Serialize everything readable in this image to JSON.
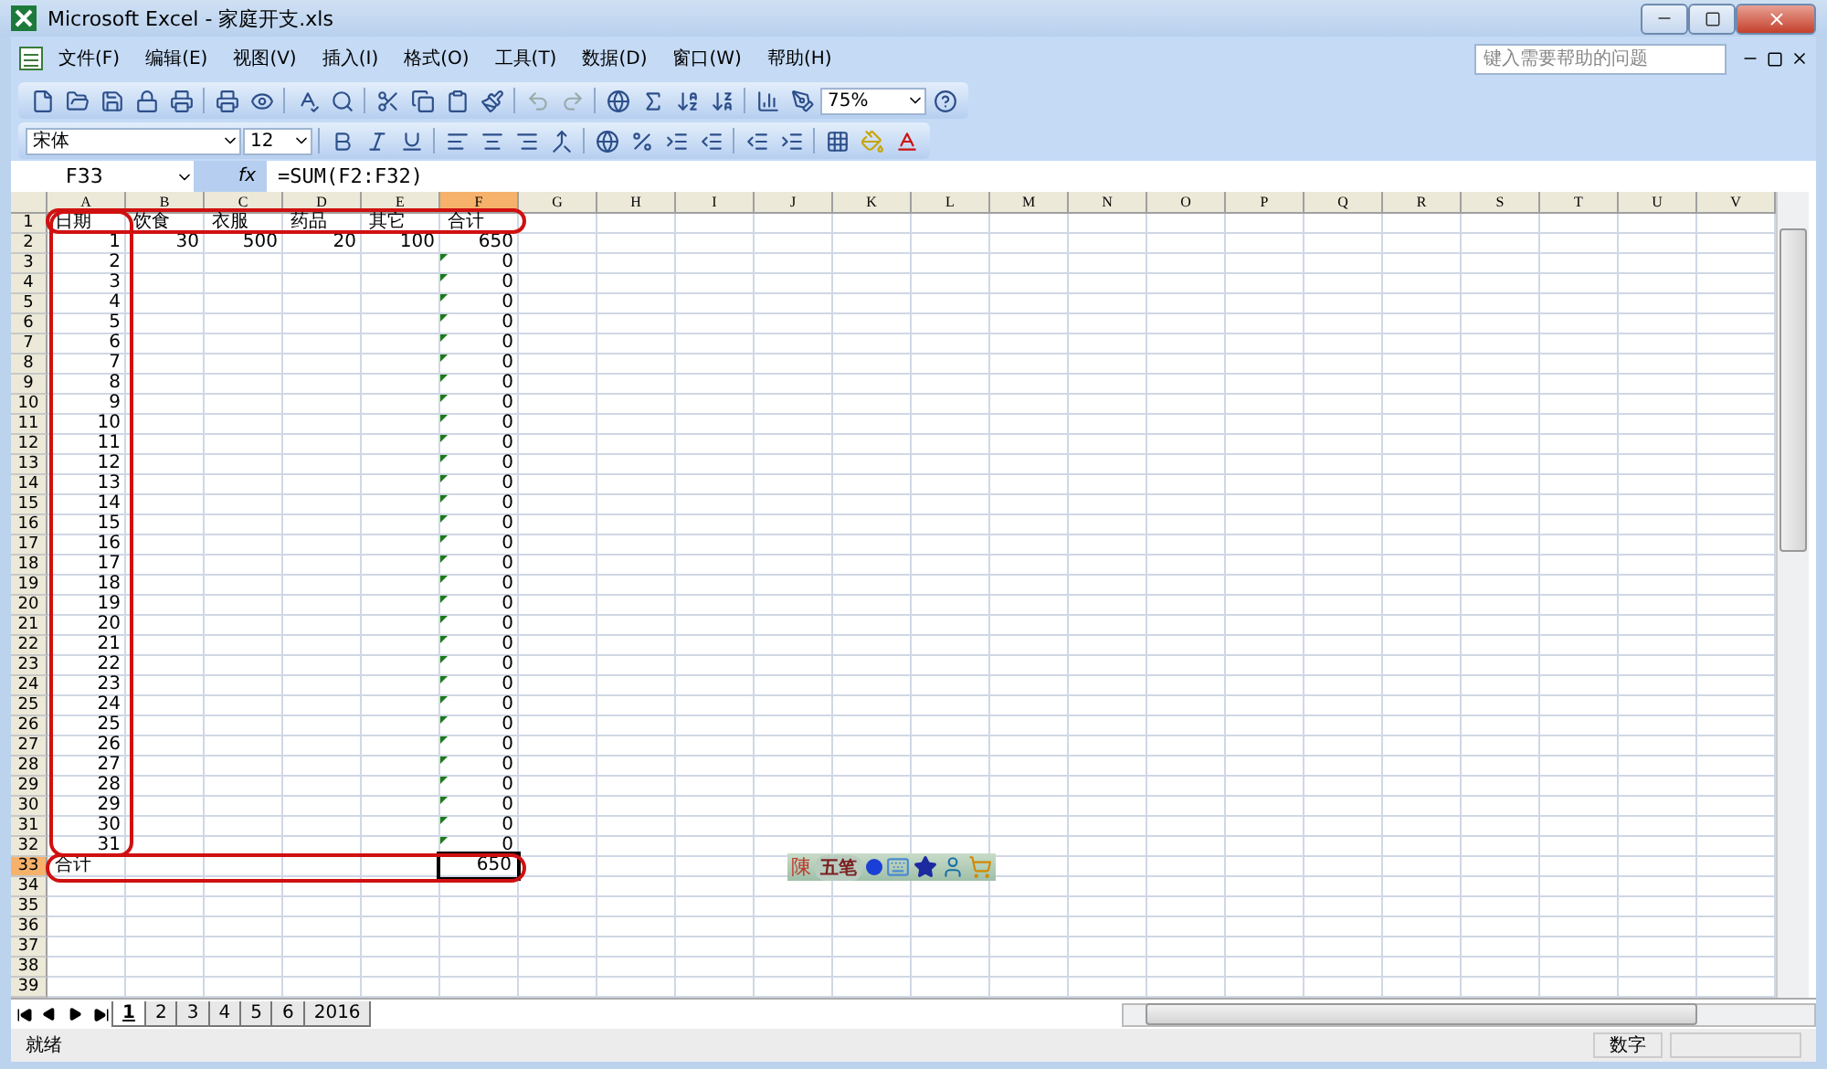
{
  "window": {
    "title": "Microsoft Excel - 家庭开支.xls"
  },
  "menu": [
    "文件(F)",
    "编辑(E)",
    "视图(V)",
    "插入(I)",
    "格式(O)",
    "工具(T)",
    "数据(D)",
    "窗口(W)",
    "帮助(H)"
  ],
  "help_box": {
    "placeholder": "键入需要帮助的问题"
  },
  "toolbar": {
    "zoom": "75%",
    "font": "宋体",
    "size": "12"
  },
  "formula_bar": {
    "name_box": "F33",
    "fx": "fx",
    "formula": "=SUM(F2:F32)"
  },
  "columns": [
    {
      "label": "A",
      "selected": false
    },
    {
      "label": "B",
      "selected": false
    },
    {
      "label": "C",
      "selected": false
    },
    {
      "label": "D",
      "selected": false
    },
    {
      "label": "E",
      "selected": false
    },
    {
      "label": "F",
      "selected": true
    },
    {
      "label": "G",
      "selected": false
    },
    {
      "label": "H",
      "selected": false
    },
    {
      "label": "I",
      "selected": false
    },
    {
      "label": "J",
      "selected": false
    },
    {
      "label": "K",
      "selected": false
    },
    {
      "label": "L",
      "selected": false
    },
    {
      "label": "M",
      "selected": false
    },
    {
      "label": "N",
      "selected": false
    },
    {
      "label": "O",
      "selected": false
    },
    {
      "label": "P",
      "selected": false
    },
    {
      "label": "Q",
      "selected": false
    },
    {
      "label": "R",
      "selected": false
    },
    {
      "label": "S",
      "selected": false
    },
    {
      "label": "T",
      "selected": false
    },
    {
      "label": "U",
      "selected": false
    },
    {
      "label": "V",
      "selected": false
    }
  ],
  "rows": [
    {
      "number": "1",
      "kind": "header",
      "selected": false,
      "cells": [
        {
          "text": "日期",
          "selected": false
        },
        {
          "text": "饮食",
          "selected": false
        },
        {
          "text": "衣服",
          "selected": false
        },
        {
          "text": "药品",
          "selected": false
        },
        {
          "text": "其它",
          "selected": false
        },
        {
          "text": "合计",
          "selected": false
        }
      ]
    },
    {
      "number": "2",
      "kind": "data",
      "selected": false,
      "cells": [
        {
          "text": "1",
          "selected": false
        },
        {
          "text": "30",
          "selected": false
        },
        {
          "text": "500",
          "selected": false
        },
        {
          "text": "20",
          "selected": false
        },
        {
          "text": "100",
          "selected": false
        },
        {
          "text": "650",
          "selected": false
        }
      ]
    },
    {
      "number": "3",
      "kind": "data",
      "selected": false,
      "flagged": true,
      "cells": [
        {
          "text": "2",
          "selected": false
        },
        null,
        null,
        null,
        null,
        {
          "text": "0",
          "selected": false
        }
      ]
    },
    {
      "number": "4",
      "kind": "data",
      "selected": false,
      "flagged": true,
      "cells": [
        {
          "text": "3",
          "selected": false
        },
        null,
        null,
        null,
        null,
        {
          "text": "0",
          "selected": false
        }
      ]
    },
    {
      "number": "5",
      "kind": "data",
      "selected": false,
      "flagged": true,
      "cells": [
        {
          "text": "4",
          "selected": false
        },
        null,
        null,
        null,
        null,
        {
          "text": "0",
          "selected": false
        }
      ]
    },
    {
      "number": "6",
      "kind": "data",
      "selected": false,
      "flagged": true,
      "cells": [
        {
          "text": "5",
          "selected": false
        },
        null,
        null,
        null,
        null,
        {
          "text": "0",
          "selected": false
        }
      ]
    },
    {
      "number": "7",
      "kind": "data",
      "selected": false,
      "flagged": true,
      "cells": [
        {
          "text": "6",
          "selected": false
        },
        null,
        null,
        null,
        null,
        {
          "text": "0",
          "selected": false
        }
      ]
    },
    {
      "number": "8",
      "kind": "data",
      "selected": false,
      "flagged": true,
      "cells": [
        {
          "text": "7",
          "selected": false
        },
        null,
        null,
        null,
        null,
        {
          "text": "0",
          "selected": false
        }
      ]
    },
    {
      "number": "9",
      "kind": "data",
      "selected": false,
      "flagged": true,
      "cells": [
        {
          "text": "8",
          "selected": false
        },
        null,
        null,
        null,
        null,
        {
          "text": "0",
          "selected": false
        }
      ]
    },
    {
      "number": "10",
      "kind": "data",
      "selected": false,
      "flagged": true,
      "cells": [
        {
          "text": "9",
          "selected": false
        },
        null,
        null,
        null,
        null,
        {
          "text": "0",
          "selected": false
        }
      ]
    },
    {
      "number": "11",
      "kind": "data",
      "selected": false,
      "flagged": true,
      "cells": [
        {
          "text": "10",
          "selected": false
        },
        null,
        null,
        null,
        null,
        {
          "text": "0",
          "selected": false
        }
      ]
    },
    {
      "number": "12",
      "kind": "data",
      "selected": false,
      "flagged": true,
      "cells": [
        {
          "text": "11",
          "selected": false
        },
        null,
        null,
        null,
        null,
        {
          "text": "0",
          "selected": false
        }
      ]
    },
    {
      "number": "13",
      "kind": "data",
      "selected": false,
      "flagged": true,
      "cells": [
        {
          "text": "12",
          "selected": false
        },
        null,
        null,
        null,
        null,
        {
          "text": "0",
          "selected": false
        }
      ]
    },
    {
      "number": "14",
      "kind": "data",
      "selected": false,
      "flagged": true,
      "cells": [
        {
          "text": "13",
          "selected": false
        },
        null,
        null,
        null,
        null,
        {
          "text": "0",
          "selected": false
        }
      ]
    },
    {
      "number": "15",
      "kind": "data",
      "selected": false,
      "flagged": true,
      "cells": [
        {
          "text": "14",
          "selected": false
        },
        null,
        null,
        null,
        null,
        {
          "text": "0",
          "selected": false
        }
      ]
    },
    {
      "number": "16",
      "kind": "data",
      "selected": false,
      "flagged": true,
      "cells": [
        {
          "text": "15",
          "selected": false
        },
        null,
        null,
        null,
        null,
        {
          "text": "0",
          "selected": false
        }
      ]
    },
    {
      "number": "17",
      "kind": "data",
      "selected": false,
      "flagged": true,
      "cells": [
        {
          "text": "16",
          "selected": false
        },
        null,
        null,
        null,
        null,
        {
          "text": "0",
          "selected": false
        }
      ]
    },
    {
      "number": "18",
      "kind": "data",
      "selected": false,
      "flagged": true,
      "cells": [
        {
          "text": "17",
          "selected": false
        },
        null,
        null,
        null,
        null,
        {
          "text": "0",
          "selected": false
        }
      ]
    },
    {
      "number": "19",
      "kind": "data",
      "selected": false,
      "flagged": true,
      "cells": [
        {
          "text": "18",
          "selected": false
        },
        null,
        null,
        null,
        null,
        {
          "text": "0",
          "selected": false
        }
      ]
    },
    {
      "number": "20",
      "kind": "data",
      "selected": false,
      "flagged": true,
      "cells": [
        {
          "text": "19",
          "selected": false
        },
        null,
        null,
        null,
        null,
        {
          "text": "0",
          "selected": false
        }
      ]
    },
    {
      "number": "21",
      "kind": "data",
      "selected": false,
      "flagged": true,
      "cells": [
        {
          "text": "20",
          "selected": false
        },
        null,
        null,
        null,
        null,
        {
          "text": "0",
          "selected": false
        }
      ]
    },
    {
      "number": "22",
      "kind": "data",
      "selected": false,
      "flagged": true,
      "cells": [
        {
          "text": "21",
          "selected": false
        },
        null,
        null,
        null,
        null,
        {
          "text": "0",
          "selected": false
        }
      ]
    },
    {
      "number": "23",
      "kind": "data",
      "selected": false,
      "flagged": true,
      "cells": [
        {
          "text": "22",
          "selected": false
        },
        null,
        null,
        null,
        null,
        {
          "text": "0",
          "selected": false
        }
      ]
    },
    {
      "number": "24",
      "kind": "data",
      "selected": false,
      "flagged": true,
      "cells": [
        {
          "text": "23",
          "selected": false
        },
        null,
        null,
        null,
        null,
        {
          "text": "0",
          "selected": false
        }
      ]
    },
    {
      "number": "25",
      "kind": "data",
      "selected": false,
      "flagged": true,
      "cells": [
        {
          "text": "24",
          "selected": false
        },
        null,
        null,
        null,
        null,
        {
          "text": "0",
          "selected": false
        }
      ]
    },
    {
      "number": "26",
      "kind": "data",
      "selected": false,
      "flagged": true,
      "cells": [
        {
          "text": "25",
          "selected": false
        },
        null,
        null,
        null,
        null,
        {
          "text": "0",
          "selected": false
        }
      ]
    },
    {
      "number": "27",
      "kind": "data",
      "selected": false,
      "flagged": true,
      "cells": [
        {
          "text": "26",
          "selected": false
        },
        null,
        null,
        null,
        null,
        {
          "text": "0",
          "selected": false
        }
      ]
    },
    {
      "number": "28",
      "kind": "data",
      "selected": false,
      "flagged": true,
      "cells": [
        {
          "text": "27",
          "selected": false
        },
        null,
        null,
        null,
        null,
        {
          "text": "0",
          "selected": false
        }
      ]
    },
    {
      "number": "29",
      "kind": "data",
      "selected": false,
      "flagged": true,
      "cells": [
        {
          "text": "28",
          "selected": false
        },
        null,
        null,
        null,
        null,
        {
          "text": "0",
          "selected": false
        }
      ]
    },
    {
      "number": "30",
      "kind": "data",
      "selected": false,
      "flagged": true,
      "cells": [
        {
          "text": "29",
          "selected": false
        },
        null,
        null,
        null,
        null,
        {
          "text": "0",
          "selected": false
        }
      ]
    },
    {
      "number": "31",
      "kind": "data",
      "selected": false,
      "flagged": true,
      "cells": [
        {
          "text": "30",
          "selected": false
        },
        null,
        null,
        null,
        null,
        {
          "text": "0",
          "selected": false
        }
      ]
    },
    {
      "number": "32",
      "kind": "data",
      "selected": false,
      "flagged": true,
      "cells": [
        {
          "text": "31",
          "selected": false
        },
        null,
        null,
        null,
        null,
        {
          "text": "0",
          "selected": false
        }
      ]
    },
    {
      "number": "33",
      "kind": "total",
      "selected": true,
      "cells": [
        {
          "text": "合计",
          "selected": false
        },
        null,
        null,
        null,
        null,
        {
          "text": "650",
          "selected": true
        }
      ]
    },
    {
      "number": "34",
      "kind": "empty",
      "selected": false
    },
    {
      "number": "35",
      "kind": "empty",
      "selected": false
    },
    {
      "number": "36",
      "kind": "empty",
      "selected": false
    },
    {
      "number": "37",
      "kind": "empty",
      "selected": false
    },
    {
      "number": "38",
      "kind": "empty",
      "selected": false
    },
    {
      "number": "39",
      "kind": "empty",
      "selected": false
    }
  ],
  "ime_bar": {
    "mark": "陳",
    "mode": "五笔"
  },
  "sheet_tabs": [
    {
      "label": "1",
      "selected": true
    },
    {
      "label": "2",
      "selected": false
    },
    {
      "label": "3",
      "selected": false
    },
    {
      "label": "4",
      "selected": false
    },
    {
      "label": "5",
      "selected": false
    },
    {
      "label": "6",
      "selected": false
    },
    {
      "label": "2016",
      "selected": false
    }
  ],
  "status_bar": {
    "left": "就绪",
    "mode": "数字"
  }
}
